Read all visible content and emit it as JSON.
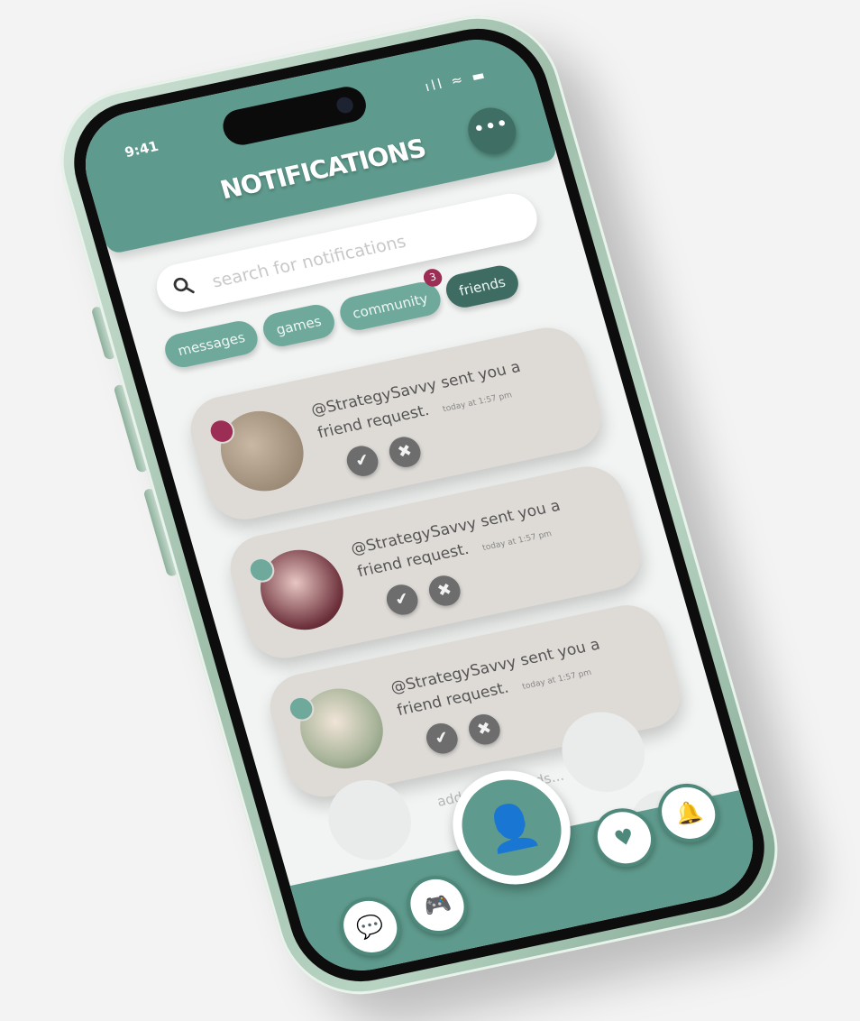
{
  "status_bar": {
    "time": "9:41",
    "icons": "ıll ≈ ▬"
  },
  "header": {
    "title": "NOTIFICATIONS",
    "more_icon": "more-dots-icon",
    "more_glyph": "•••"
  },
  "search": {
    "placeholder": "search for notifications"
  },
  "tabs": [
    {
      "label": "messages",
      "active": false
    },
    {
      "label": "games",
      "active": false
    },
    {
      "label": "community",
      "active": false,
      "badge": "3"
    },
    {
      "label": "friends",
      "active": true
    }
  ],
  "notifications": [
    {
      "text": "@StrategySavvy sent you a friend request.",
      "time": "today at 1:57 pm",
      "status_color": "#9c2e55"
    },
    {
      "text": "@StrategySavvy sent you a friend request.",
      "time": "today at 1:57 pm",
      "status_color": "#6fa99b"
    },
    {
      "text": "@StrategySavvy sent you a friend request.",
      "time": "today at 1:57 pm",
      "status_color": "#6fa99b"
    }
  ],
  "actions": {
    "accept_glyph": "✔",
    "decline_glyph": "✖"
  },
  "add_more": "add more friends...",
  "bottom_nav": {
    "chat_glyph": "💬",
    "games_glyph": "🎮",
    "profile_glyph": "👤",
    "heart_glyph": "♥",
    "bell_glyph": "🔔"
  },
  "colors": {
    "accent": "#5e9a8d",
    "dark_accent": "#3e6c62",
    "badge": "#9c2e55",
    "card": "#dedbd7"
  }
}
